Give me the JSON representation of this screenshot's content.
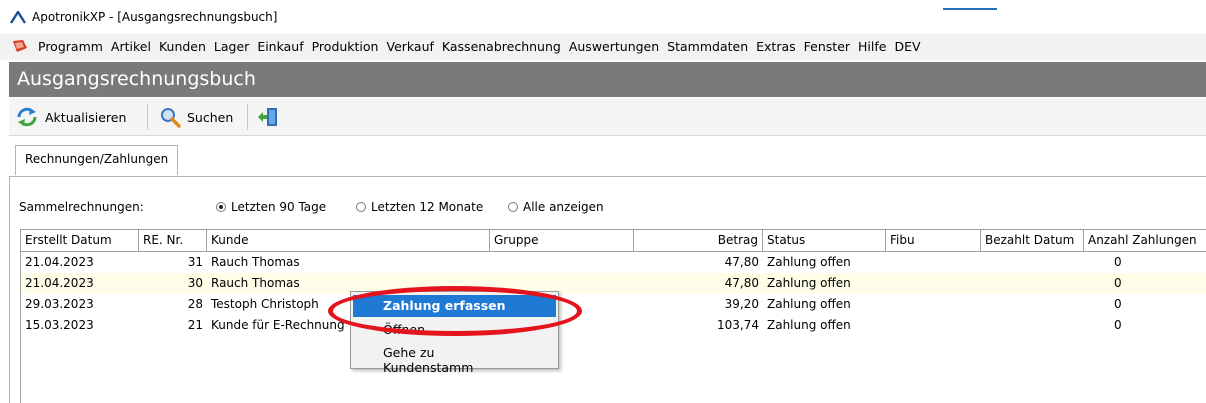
{
  "window": {
    "title": "ApotronikXP  - [Ausgangsrechnungsbuch]"
  },
  "menu": [
    "Programm",
    "Artikel",
    "Kunden",
    "Lager",
    "Einkauf",
    "Produktion",
    "Verkauf",
    "Kassenabrechnung",
    "Auswertungen",
    "Stammdaten",
    "Extras",
    "Fenster",
    "Hilfe",
    "DEV"
  ],
  "panel": {
    "title": "Ausgangsrechnungsbuch"
  },
  "toolbar": {
    "refresh": "Aktualisieren",
    "search": "Suchen"
  },
  "tabs": [
    "Rechnungen/Zahlungen"
  ],
  "filter": {
    "label": "Sammelrechnungen:",
    "options": [
      "Letzten 90 Tage",
      "Letzten 12 Monate",
      "Alle anzeigen"
    ],
    "selected": "Letzten 90 Tage"
  },
  "grid": {
    "columns": [
      "Erstellt Datum",
      "RE. Nr.",
      "Kunde",
      "Gruppe",
      "Betrag",
      "Status",
      "Fibu",
      "Bezahlt Datum",
      "Anzahl Zahlungen"
    ],
    "rows": [
      [
        "21.04.2023",
        "31",
        "Rauch Thomas",
        "",
        "47,80",
        "Zahlung offen",
        "",
        "",
        "0"
      ],
      [
        "21.04.2023",
        "30",
        "Rauch Thomas",
        "",
        "47,80",
        "Zahlung offen",
        "",
        "",
        "0"
      ],
      [
        "29.03.2023",
        "28",
        "Testoph Christoph",
        "",
        "39,20",
        "Zahlung offen",
        "",
        "",
        "0"
      ],
      [
        "15.03.2023",
        "21",
        "Kunde für E-Rechnung",
        "",
        "103,74",
        "Zahlung offen",
        "",
        "",
        "0"
      ]
    ],
    "highlighted_row": 1
  },
  "context_menu": {
    "items": [
      "Zahlung erfassen",
      "Öffnen",
      "Gehe zu Kundenstamm"
    ],
    "selected": "Zahlung erfassen"
  },
  "colors": {
    "header_bg": "#7a7a7a",
    "row_highlight": "#fdfde8",
    "menu_selection": "#1f7ad6",
    "annotation": "#e3141b"
  }
}
